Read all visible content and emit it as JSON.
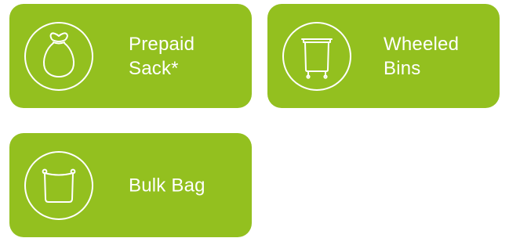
{
  "options": [
    {
      "lines": [
        "Prepaid",
        "Sack*"
      ],
      "icon": "sack-icon"
    },
    {
      "lines": [
        "Wheeled",
        "Bins"
      ],
      "icon": "wheeled-bin-icon"
    },
    {
      "lines": [
        "Bulk Bag"
      ],
      "icon": "bulk-bag-icon"
    }
  ],
  "colors": {
    "tile": "#93c01f",
    "text": "#ffffff",
    "icon_stroke": "#ffffff"
  }
}
